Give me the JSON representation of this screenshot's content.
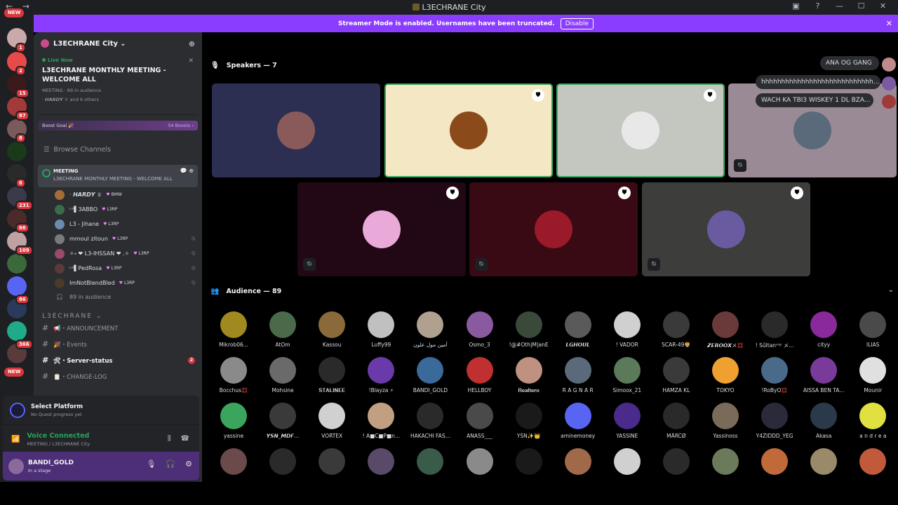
{
  "window": {
    "title": "L3ECHRANE City",
    "back_icon": "←",
    "forward_icon": "→",
    "controls": [
      "▣",
      "?",
      "—",
      "☐",
      "✕"
    ]
  },
  "banner": {
    "text": "Streamer Mode is enabled. Usernames have been truncated.",
    "button": "Disable",
    "close": "✕",
    "color": "#8b3dff"
  },
  "rail": {
    "new_label": "NEW",
    "badges": [
      "1",
      "2",
      "15",
      "87",
      "8",
      "6",
      "231",
      "66",
      "109",
      "86",
      "366"
    ]
  },
  "server": {
    "name": "L3ECHRANE City",
    "chevron": "⌄",
    "live": {
      "label": "Live Now",
      "title": "L3ECHRANE MONTHLY MEETING - WELCOME ALL",
      "meta": "MEETING  ·  89 in audience",
      "people": "· 𝙃𝘼𝙍𝘿𝙔 ♕ and 6 others",
      "close": "✕"
    },
    "boost": {
      "label": "Boost Goal 🎉",
      "count": "54 Boosts ›"
    },
    "browse": "Browse Channels",
    "active_channel": {
      "name": "MEETING",
      "topic": "L3ECHRANE MONTHLY MEETING - WELCOME ALL"
    },
    "members": [
      {
        "name": "· 𝙃𝘼𝙍𝘿𝙔 ♕",
        "tag": "BMW",
        "color": "#a56b3a"
      },
      {
        "name": "ᶫᵒ▌3ABBO",
        "tag": "L3RP",
        "color": "#3a6b4a"
      },
      {
        "name": "L3 - Jihane",
        "tag": "L3RP",
        "color": "#6b8ab0"
      },
      {
        "name": "mmoul zitoun",
        "tag": "L3RP",
        "color": "#7a7a7a"
      },
      {
        "name": "✧˖ ❤ L3-IHSSAN ❤ .✧",
        "tag": "L3RP",
        "color": "#9a4a6a"
      },
      {
        "name": "ᶫᵒ▌PedRosa",
        "tag": "L3RP",
        "color": "#5a3a3a"
      },
      {
        "name": "ImNotBlendBled",
        "tag": "L3RP",
        "color": "#4a3a2a"
      }
    ],
    "audience_line": "89 in audience",
    "category": "L3ECHRANE",
    "channels": [
      {
        "name": "📢・ANNOUNCEMENT",
        "badge": ""
      },
      {
        "name": "🎉・Events",
        "badge": ""
      },
      {
        "name": "🛠・Server-status",
        "badge": "2"
      },
      {
        "name": "📋・CHANGE-LOG",
        "badge": ""
      }
    ]
  },
  "panel": {
    "platform_title": "Select Platform",
    "platform_sub": "No Quest progress yet",
    "voice_title": "Voice Connected",
    "voice_sub": "MEETING / L3ECHRANE City",
    "user_name": "BANDI_GOLD",
    "user_status": "In a stage"
  },
  "stage": {
    "speakers_label": "Speakers — 7",
    "audience_label": "Audience — 89",
    "speakers": [
      {
        "bg": "#2c2f52",
        "av": "#8a5a5a",
        "speaking": false,
        "mod": false,
        "muted": false
      },
      {
        "bg": "#f3e7c4",
        "av": "#8a4a1a",
        "speaking": true,
        "mod": true,
        "muted": false
      },
      {
        "bg": "#c3c7c0",
        "av": "#e8e8e8",
        "speaking": true,
        "mod": true,
        "muted": false
      },
      {
        "bg": "#9a8a96",
        "av": "#5a6a7a",
        "speaking": false,
        "mod": false,
        "muted": true
      },
      {
        "bg": "#220814",
        "av": "#e9a9d9",
        "speaking": false,
        "mod": true,
        "muted": true
      },
      {
        "bg": "#3a0a14",
        "av": "#9a1a2a",
        "speaking": false,
        "mod": true,
        "muted": true
      },
      {
        "bg": "#3d3d3b",
        "av": "#6a5aa0",
        "speaking": false,
        "mod": true,
        "muted": true
      }
    ],
    "messages": [
      {
        "text": "ANA OG GANG"
      },
      {
        "text": "hhhhhhhhhhhhhhhhhhhhhhhhhhhh..."
      },
      {
        "text": "WACH KA TBI3 WISKEY 1 DL BZA..."
      }
    ],
    "audience": [
      [
        "Mikrob06...",
        "AtOm",
        "Kassou",
        "Luffy99",
        "أمين مول علون",
        "Osmo_3",
        "!@#Oth|M|anE",
        "𝙇𝙂𝙃𝙊𝙐𝙇",
        "! VADOR",
        "SCAR-49🦁",
        "𝙕𝙀𝙍𝙊𝙊𝙓メ💢",
        "! Sűltanᵛᶦᵖ メ...",
        "cityy",
        "ILIAS"
      ],
      [
        "Bocchus💢",
        "Mohsine",
        "𝐒𝐓𝐀𝐋𝐈𝐍𝐄𝐄",
        "!Blayza ⚡",
        "BANDI_GOLD",
        "HELLBOY",
        "𝐑𝐞𝐚𝐥𝐭𝐞𝐫𝐨",
        "R A G N A R",
        "Simoox_21",
        "HAMZA KL",
        "TOKYO",
        "!RoByO💢",
        "AISSA BEN TA...",
        "Mounir"
      ],
      [
        "yassine",
        "𝙔𝙎𝙉_𝙈𝘿𝙁...",
        "VORTEX",
        "! A■C■P■n...",
        "HAKACHI FAS...",
        "ANASS___",
        "YSN✨👑",
        "aminemoney",
        "YASSINE",
        "MÃRCØ",
        "Yassinoss",
        "Y4ZIDDD_YEG",
        "Akasa",
        "a n d r e a"
      ],
      [
        "",
        "",
        "",
        "",
        "",
        "",
        "",
        "",
        "",
        "",
        "",
        "",
        "",
        ""
      ]
    ],
    "audience_colors": [
      [
        "#a08a20",
        "#4a6a4a",
        "#8a6a3a",
        "#c0c0c0",
        "#b0a090",
        "#8a5aa0",
        "#3a4a3a",
        "#5a5a5a",
        "#d0d0d0",
        "#3a3a3a",
        "#6a3a3a",
        "#2a2a2a",
        "#8a2a9a",
        "#4a4a4a"
      ],
      [
        "#8a8a8a",
        "#6a6a6a",
        "#2a2a2a",
        "#6a3aaa",
        "#3a6a9a",
        "#c03030",
        "#c09080",
        "#5a6a7a",
        "#5a7a5a",
        "#3a3a3a",
        "#f0a030",
        "#4a6a8a",
        "#7a3a9a",
        "#e0e0e0"
      ],
      [
        "#3ba55c",
        "#3a3a3a",
        "#d0d0d0",
        "#c0a080",
        "#2a2a2a",
        "#4a4a4a",
        "#1a1a1a",
        "#5865f2",
        "#4a2a8a",
        "#2a2a2a",
        "#7a6a5a",
        "#2a2a3a",
        "#2a3a4a",
        "#e0e040"
      ],
      [
        "#6a4a4a",
        "#2a2a2a",
        "#3a3a3a",
        "#5a4a6a",
        "#3a5a4a",
        "#8a8a8a",
        "#1a1a1a",
        "#a06a4a",
        "#d0d0d0",
        "#2a2a2a",
        "#6a7a5a",
        "#c06a3a",
        "#9a8a6a",
        "#c05a3a"
      ]
    ]
  }
}
